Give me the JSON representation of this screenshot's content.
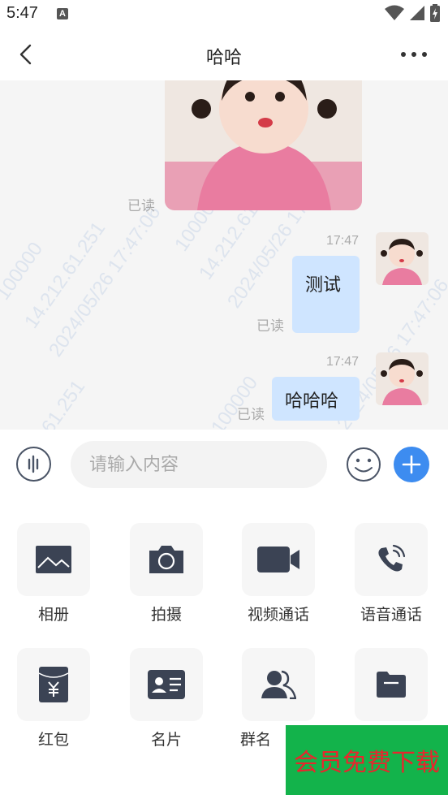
{
  "status_bar": {
    "time": "5:47",
    "notif_glyph": "A"
  },
  "header": {
    "title": "哈哈"
  },
  "watermarks": [
    "100000",
    "14.212.61.251",
    "2024/05/26 17:47:06"
  ],
  "messages": [
    {
      "type": "image",
      "read": "已读"
    },
    {
      "type": "text",
      "time": "17:47",
      "text": "测试",
      "read": "已读"
    },
    {
      "type": "text",
      "time": "17:47",
      "text": "哈哈哈",
      "read": "已读"
    }
  ],
  "input": {
    "placeholder": "请输入内容",
    "value": ""
  },
  "panel": {
    "items": [
      {
        "label": "相册",
        "icon": "photo-album-icon"
      },
      {
        "label": "拍摄",
        "icon": "camera-icon"
      },
      {
        "label": "视频通话",
        "icon": "video-call-icon"
      },
      {
        "label": "语音通话",
        "icon": "voice-call-icon"
      },
      {
        "label": "红包",
        "icon": "red-packet-icon"
      },
      {
        "label": "名片",
        "icon": "business-card-icon"
      },
      {
        "label": "群名",
        "icon": "group-icon"
      },
      {
        "label": "",
        "icon": "folder-icon"
      }
    ]
  },
  "promo": {
    "label": "会员免费下载"
  },
  "colors": {
    "accent": "#3d8cf0",
    "bubble": "#cfe5ff",
    "icon": "#3b4354",
    "promo_bg": "#13b34b",
    "promo_text": "#e8262d"
  }
}
